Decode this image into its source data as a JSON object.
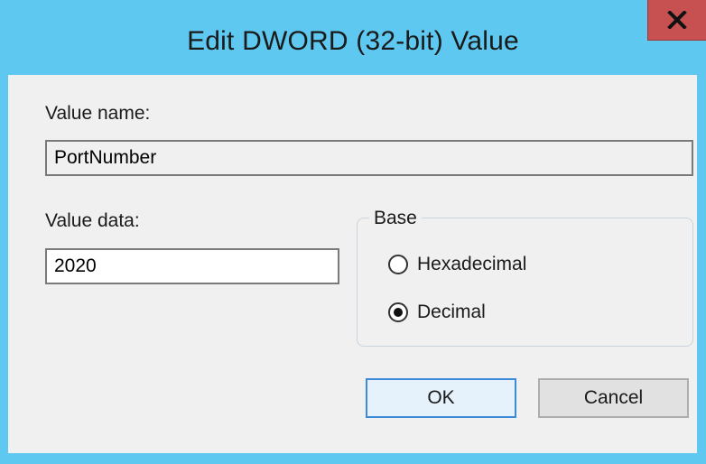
{
  "dialog": {
    "title": "Edit DWORD (32-bit) Value",
    "close_glyph": "x"
  },
  "value_name": {
    "label": "Value name:",
    "value": "PortNumber"
  },
  "value_data": {
    "label": "Value data:",
    "value": "2020"
  },
  "base": {
    "legend": "Base",
    "options": [
      {
        "label": "Hexadecimal",
        "selected": false
      },
      {
        "label": "Decimal",
        "selected": true
      }
    ]
  },
  "buttons": {
    "ok": "OK",
    "cancel": "Cancel"
  },
  "colors": {
    "titlebar": "#5ec8f0",
    "close": "#c75050",
    "client": "#f0f0f0"
  },
  "icons": {
    "close": "close-icon"
  }
}
